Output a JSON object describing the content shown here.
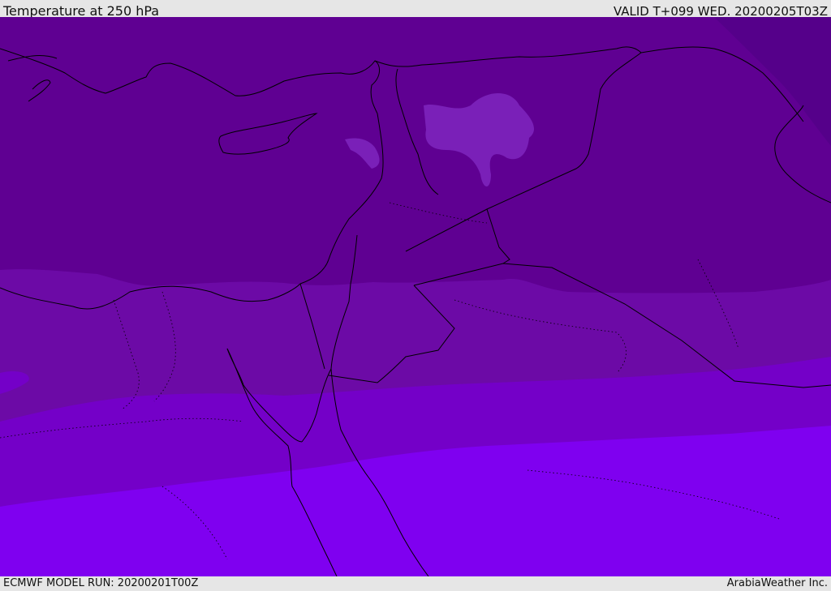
{
  "header": {
    "title": "Temperature at 250 hPa",
    "valid": "VALID T+099 WED. 20200205T03Z"
  },
  "footer": {
    "model_run": "ECMWF MODEL RUN: 20200201T00Z",
    "credit": "ArabiaWeather Inc."
  },
  "map": {
    "fill_colors": {
      "band_coldest": "#55008a",
      "band_1": "#5f0092",
      "band_2": "#6c0aa6",
      "band_3": "#7400c8",
      "band_4": "#7d00f5",
      "band_5": "#8000ff",
      "light_patch": "#7a20b8"
    },
    "line_color": "#000000"
  }
}
